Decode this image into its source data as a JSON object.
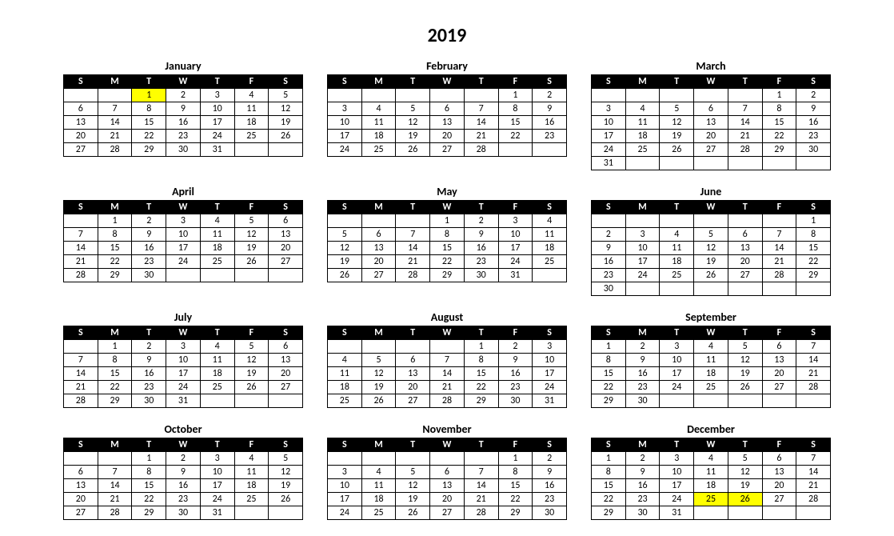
{
  "year": "2019",
  "weekdays": [
    "S",
    "M",
    "T",
    "W",
    "T",
    "F",
    "S"
  ],
  "highlights": {
    "January": [
      1
    ],
    "December": [
      25,
      26
    ]
  },
  "months": [
    {
      "name": "January",
      "startDay": 2,
      "days": 31
    },
    {
      "name": "February",
      "startDay": 5,
      "days": 28
    },
    {
      "name": "March",
      "startDay": 5,
      "days": 31
    },
    {
      "name": "April",
      "startDay": 1,
      "days": 30
    },
    {
      "name": "May",
      "startDay": 3,
      "days": 31
    },
    {
      "name": "June",
      "startDay": 6,
      "days": 30
    },
    {
      "name": "July",
      "startDay": 1,
      "days": 31
    },
    {
      "name": "August",
      "startDay": 4,
      "days": 31
    },
    {
      "name": "September",
      "startDay": 0,
      "days": 30
    },
    {
      "name": "October",
      "startDay": 2,
      "days": 31
    },
    {
      "name": "November",
      "startDay": 5,
      "days": 30
    },
    {
      "name": "December",
      "startDay": 0,
      "days": 31
    }
  ]
}
